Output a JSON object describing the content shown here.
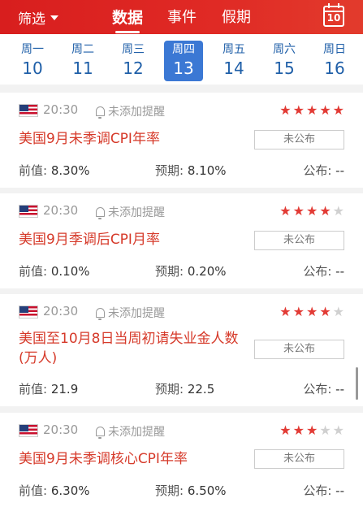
{
  "header": {
    "filter_label": "筛选",
    "tabs": [
      {
        "label": "数据",
        "active": true
      },
      {
        "label": "事件",
        "active": false
      },
      {
        "label": "假期",
        "active": false
      }
    ],
    "calendar_day": "10"
  },
  "week": [
    {
      "name": "周一",
      "date": "10",
      "active": false
    },
    {
      "name": "周二",
      "date": "11",
      "active": false
    },
    {
      "name": "周三",
      "date": "12",
      "active": false
    },
    {
      "name": "周四",
      "date": "13",
      "active": true
    },
    {
      "name": "周五",
      "date": "14",
      "active": false
    },
    {
      "name": "周六",
      "date": "15",
      "active": false
    },
    {
      "name": "周日",
      "date": "16",
      "active": false
    }
  ],
  "labels": {
    "previous": "前值:",
    "forecast": "预期:",
    "published": "公布:"
  },
  "events": [
    {
      "time": "20:30",
      "reminder": "未添加提醒",
      "stars": 5,
      "title": "美国9月未季调CPI年率",
      "status": "未公布",
      "previous": "8.30%",
      "forecast": "8.10%",
      "actual": "--"
    },
    {
      "time": "20:30",
      "reminder": "未添加提醒",
      "stars": 4,
      "title": "美国9月季调后CPI月率",
      "status": "未公布",
      "previous": "0.10%",
      "forecast": "0.20%",
      "actual": "--"
    },
    {
      "time": "20:30",
      "reminder": "未添加提醒",
      "stars": 4,
      "title": "美国至10月8日当周初请失业金人数(万人)",
      "status": "未公布",
      "previous": "21.9",
      "forecast": "22.5",
      "actual": "--"
    },
    {
      "time": "20:30",
      "reminder": "未添加提醒",
      "stars": 3,
      "title": "美国9月未季调核心CPI年率",
      "status": "未公布",
      "previous": "6.30%",
      "forecast": "6.50%",
      "actual": "--"
    }
  ]
}
